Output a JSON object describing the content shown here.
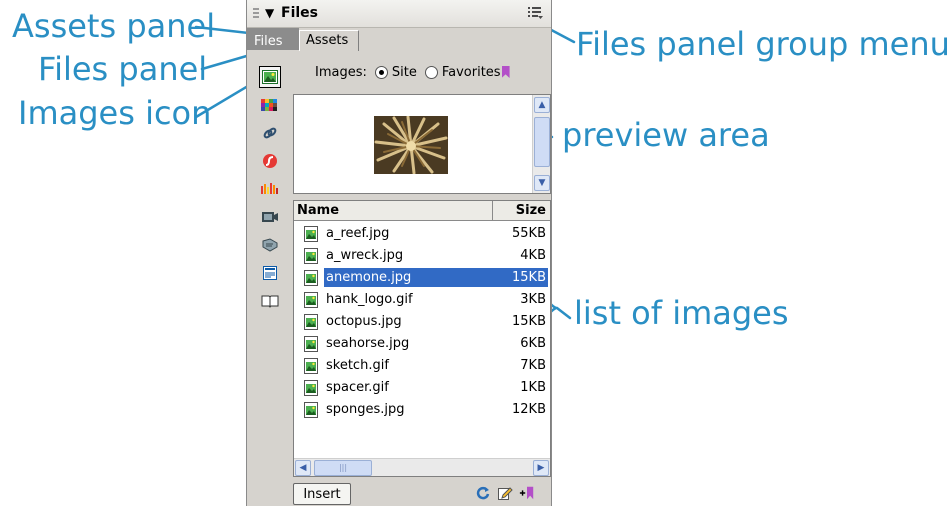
{
  "callouts": {
    "assets_panel": "Assets panel",
    "files_panel": "Files panel",
    "images_icon": "Images icon",
    "files_panel_group_menu": "Files panel group menu",
    "preview_area": "preview area",
    "list_of_images": "list of images"
  },
  "panel": {
    "title": "Files",
    "tabs": {
      "files": "Files",
      "assets": "Assets"
    },
    "images_label": "Images:",
    "radio_site": "Site",
    "radio_favorites": "Favorites",
    "columns": {
      "name": "Name",
      "size": "Size"
    },
    "files": [
      {
        "name": "a_reef.jpg",
        "size": "55KB"
      },
      {
        "name": "a_wreck.jpg",
        "size": "4KB"
      },
      {
        "name": "anemone.jpg",
        "size": "15KB"
      },
      {
        "name": "hank_logo.gif",
        "size": "3KB"
      },
      {
        "name": "octopus.jpg",
        "size": "15KB"
      },
      {
        "name": "seahorse.jpg",
        "size": "6KB"
      },
      {
        "name": "sketch.gif",
        "size": "7KB"
      },
      {
        "name": "spacer.gif",
        "size": "1KB"
      },
      {
        "name": "sponges.jpg",
        "size": "12KB"
      }
    ],
    "selected_file": "anemone.jpg",
    "insert_button": "Insert",
    "scrollbar_grip": "|||"
  },
  "colors": {
    "callout": "#2a8fc4",
    "selection": "#316ac5",
    "panel_bg": "#d6d3ce"
  }
}
